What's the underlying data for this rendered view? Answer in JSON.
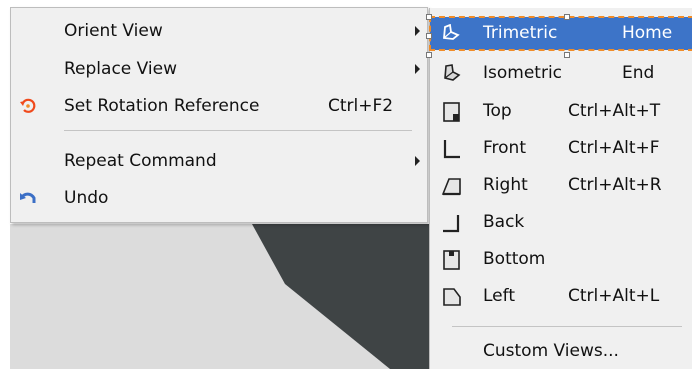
{
  "context_menu": {
    "items": [
      {
        "label": "Orient View",
        "shortcut": "",
        "has_submenu": true,
        "icon": ""
      },
      {
        "label": "Replace View",
        "shortcut": "",
        "has_submenu": true,
        "icon": ""
      },
      {
        "label": "Set Rotation Reference",
        "shortcut": "Ctrl+F2",
        "has_submenu": false,
        "icon": "rotation-reference-icon"
      },
      {
        "label": "Repeat Command",
        "shortcut": "",
        "has_submenu": true,
        "icon": ""
      },
      {
        "label": "Undo",
        "shortcut": "",
        "has_submenu": false,
        "icon": "undo-icon"
      }
    ]
  },
  "orient_submenu": {
    "items": [
      {
        "label": "Trimetric",
        "shortcut": "Home",
        "icon": "trimetric-view-icon",
        "highlighted": true
      },
      {
        "label": "Isometric",
        "shortcut": "End",
        "icon": "isometric-view-icon"
      },
      {
        "label": "Top",
        "shortcut": "Ctrl+Alt+T",
        "icon": "top-view-icon"
      },
      {
        "label": "Front",
        "shortcut": "Ctrl+Alt+F",
        "icon": "front-view-icon"
      },
      {
        "label": "Right",
        "shortcut": "Ctrl+Alt+R",
        "icon": "right-view-icon"
      },
      {
        "label": "Back",
        "shortcut": "",
        "icon": "back-view-icon"
      },
      {
        "label": "Bottom",
        "shortcut": "",
        "icon": "bottom-view-icon"
      },
      {
        "label": "Left",
        "shortcut": "Ctrl+Alt+L",
        "icon": "left-view-icon"
      },
      {
        "label": "Custom Views...",
        "shortcut": "",
        "icon": ""
      }
    ]
  },
  "colors": {
    "menu_bg": "#f0f0f0",
    "highlight": "#3d74c8",
    "highlight_outline": "#f08c28",
    "scene_bg": "#dcdcdc",
    "model_fill": "#3f4445"
  }
}
